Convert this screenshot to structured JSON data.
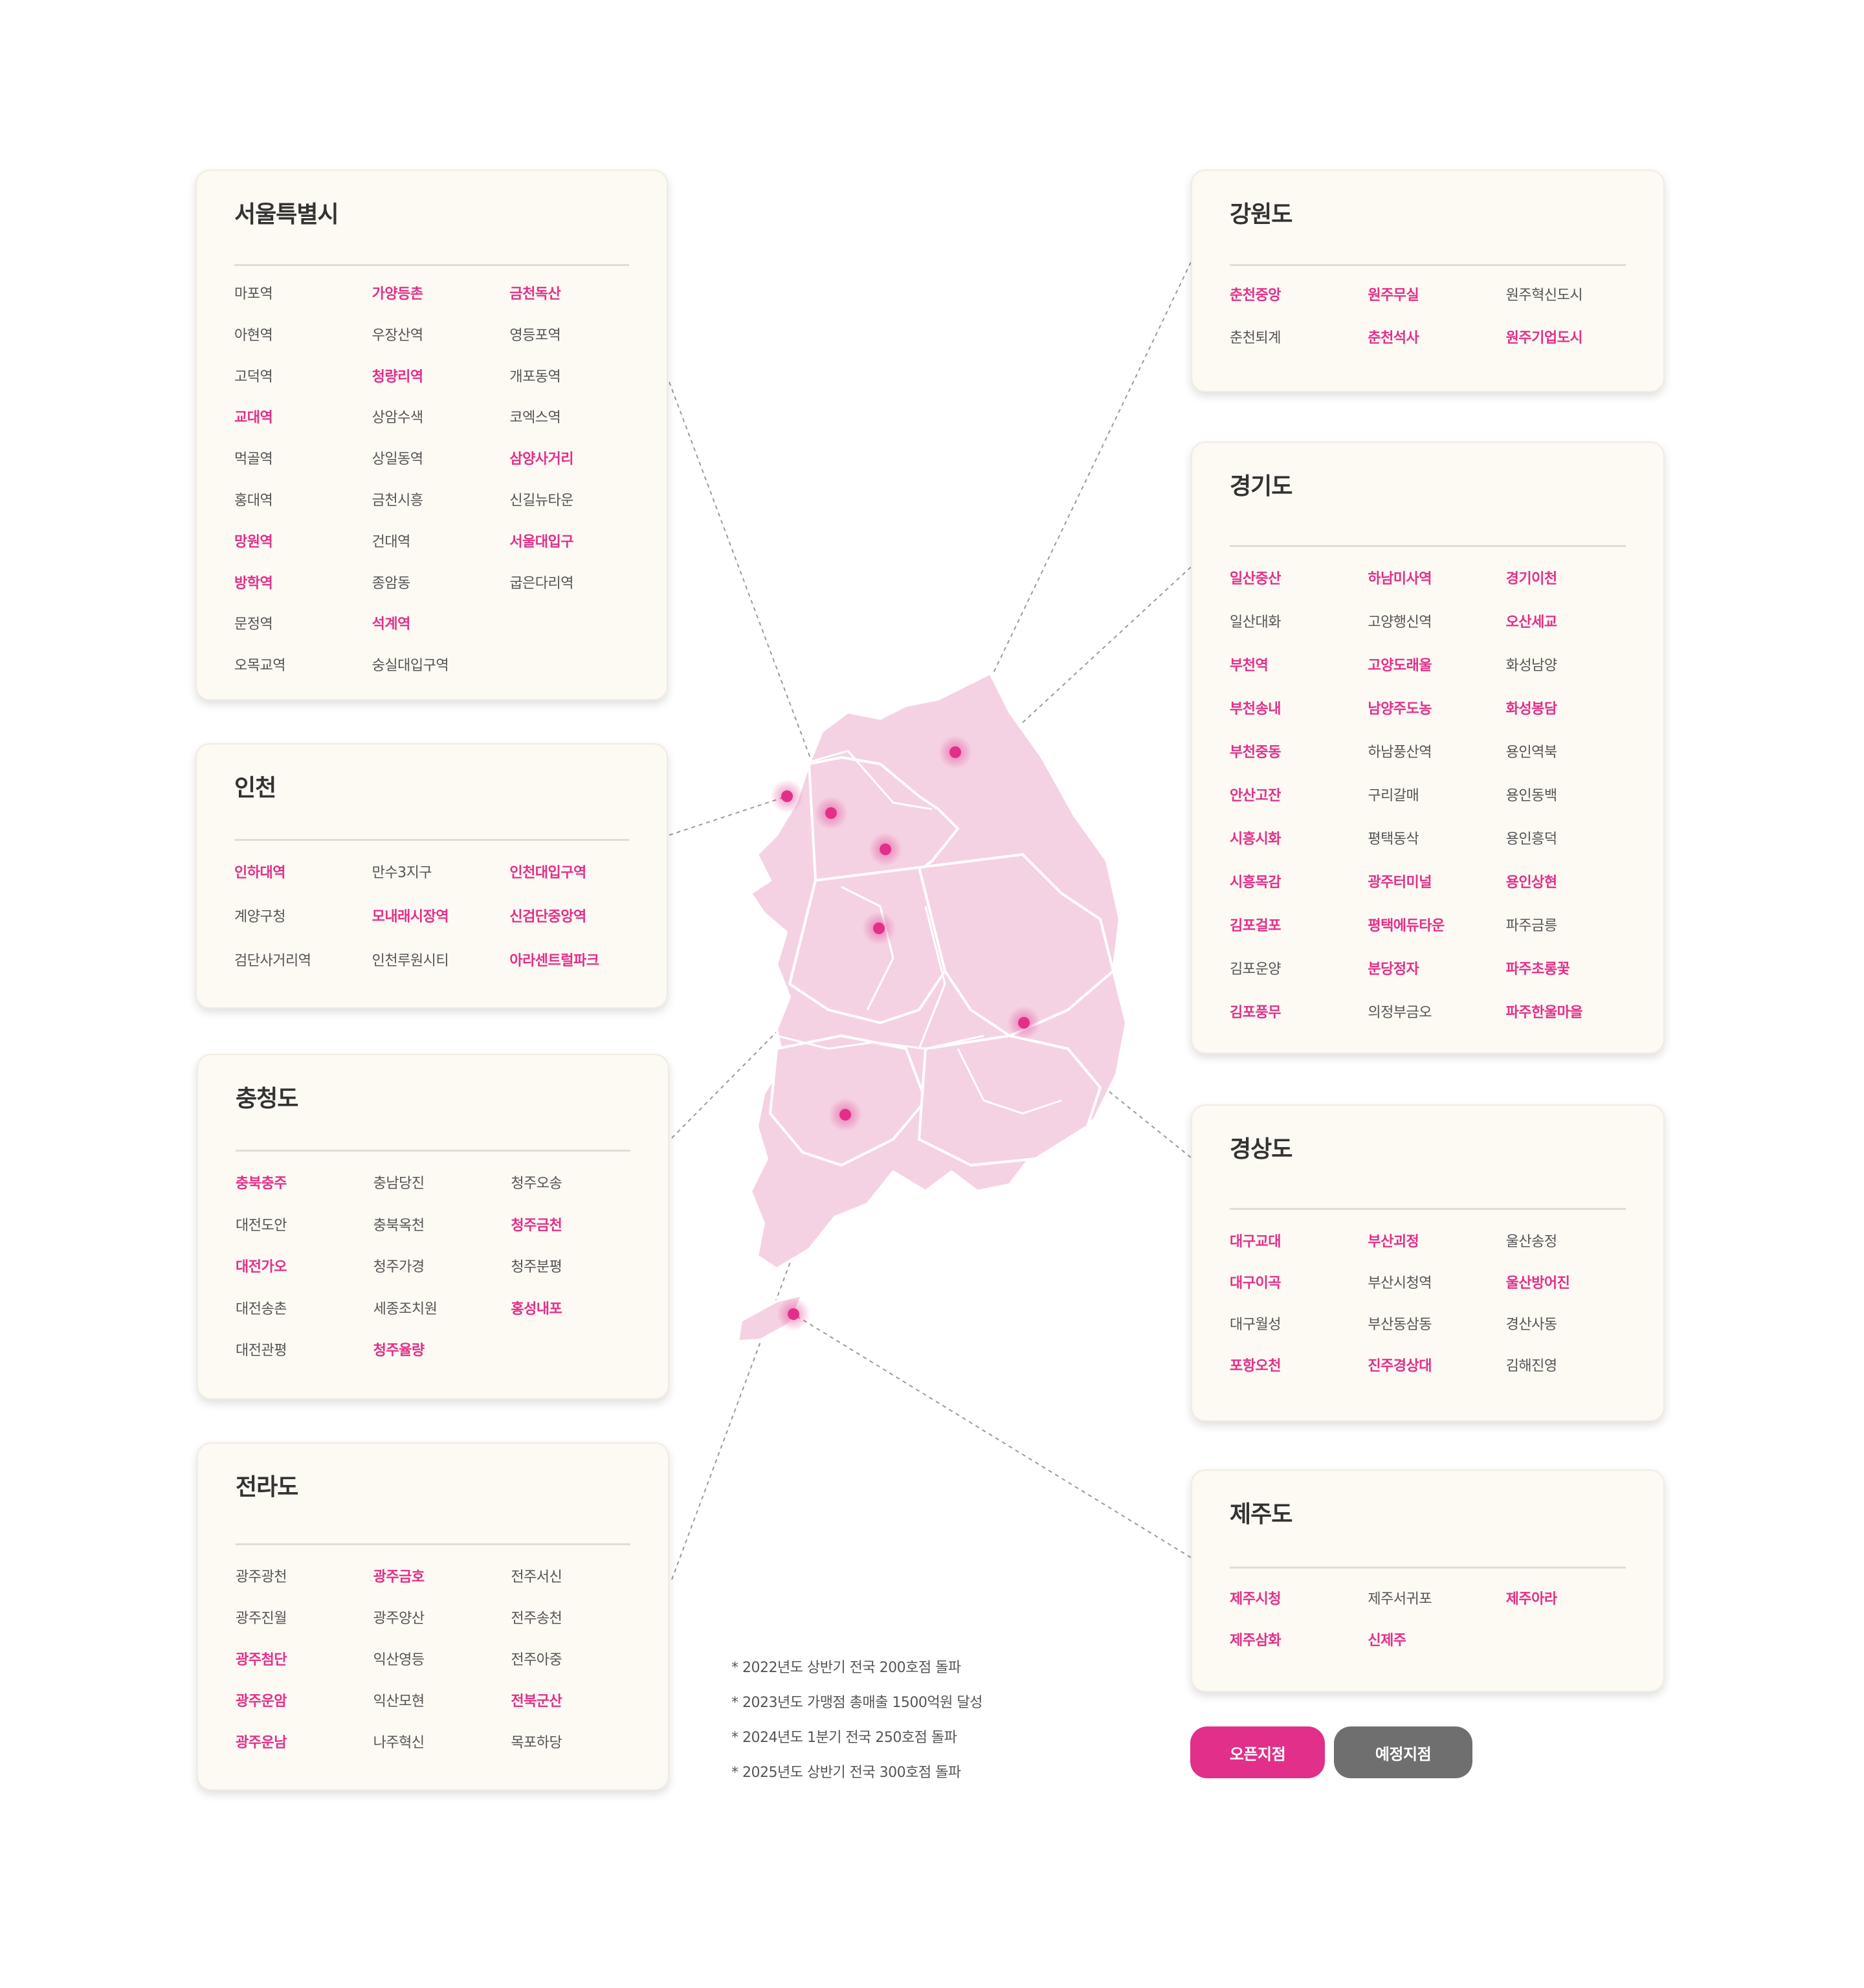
{
  "regions": {
    "seoul": {
      "title": "서울특별시",
      "items": [
        {
          "name": "마포역",
          "open": false
        },
        {
          "name": "가양등촌",
          "open": true
        },
        {
          "name": "금천독산",
          "open": true
        },
        {
          "name": "아현역",
          "open": false
        },
        {
          "name": "우장산역",
          "open": false
        },
        {
          "name": "영등포역",
          "open": false
        },
        {
          "name": "고덕역",
          "open": false
        },
        {
          "name": "청량리역",
          "open": true
        },
        {
          "name": "개포동역",
          "open": false
        },
        {
          "name": "교대역",
          "open": true
        },
        {
          "name": "상암수색",
          "open": false
        },
        {
          "name": "코엑스역",
          "open": false
        },
        {
          "name": "먹골역",
          "open": false
        },
        {
          "name": "상일동역",
          "open": false
        },
        {
          "name": "삼양사거리",
          "open": true
        },
        {
          "name": "홍대역",
          "open": false
        },
        {
          "name": "금천시흥",
          "open": false
        },
        {
          "name": "신길뉴타운",
          "open": false
        },
        {
          "name": "망원역",
          "open": true
        },
        {
          "name": "건대역",
          "open": false
        },
        {
          "name": "서울대입구",
          "open": true
        },
        {
          "name": "방학역",
          "open": true
        },
        {
          "name": "종암동",
          "open": false
        },
        {
          "name": "굽은다리역",
          "open": false
        },
        {
          "name": "문정역",
          "open": false
        },
        {
          "name": "석계역",
          "open": true
        },
        {
          "name": "",
          "open": false
        },
        {
          "name": "오목교역",
          "open": false
        },
        {
          "name": "숭실대입구역",
          "open": false
        },
        {
          "name": "",
          "open": false
        }
      ]
    },
    "incheon": {
      "title": "인천",
      "items": [
        {
          "name": "인하대역",
          "open": true
        },
        {
          "name": "만수3지구",
          "open": false
        },
        {
          "name": "인천대입구역",
          "open": true
        },
        {
          "name": "계양구청",
          "open": false
        },
        {
          "name": "모내래시장역",
          "open": true
        },
        {
          "name": "신검단중앙역",
          "open": true
        },
        {
          "name": "검단사거리역",
          "open": false
        },
        {
          "name": "인천루원시티",
          "open": false
        },
        {
          "name": "아라센트럴파크",
          "open": true
        }
      ]
    },
    "chungcheong": {
      "title": "충청도",
      "items": [
        {
          "name": "충북충주",
          "open": true
        },
        {
          "name": "충남당진",
          "open": false
        },
        {
          "name": "청주오송",
          "open": false
        },
        {
          "name": "대전도안",
          "open": false
        },
        {
          "name": "충북옥천",
          "open": false
        },
        {
          "name": "청주금천",
          "open": true
        },
        {
          "name": "대전가오",
          "open": true
        },
        {
          "name": "청주가경",
          "open": false
        },
        {
          "name": "청주분평",
          "open": false
        },
        {
          "name": "대전송촌",
          "open": false
        },
        {
          "name": "세종조치원",
          "open": false
        },
        {
          "name": "홍성내포",
          "open": true
        },
        {
          "name": "대전관평",
          "open": false
        },
        {
          "name": "청주율량",
          "open": true
        },
        {
          "name": "",
          "open": false
        }
      ]
    },
    "jeolla": {
      "title": "전라도",
      "items": [
        {
          "name": "광주광천",
          "open": false
        },
        {
          "name": "광주금호",
          "open": true
        },
        {
          "name": "전주서신",
          "open": false
        },
        {
          "name": "광주진월",
          "open": false
        },
        {
          "name": "광주양산",
          "open": false
        },
        {
          "name": "전주송천",
          "open": false
        },
        {
          "name": "광주첨단",
          "open": true
        },
        {
          "name": "익산영등",
          "open": false
        },
        {
          "name": "전주아중",
          "open": false
        },
        {
          "name": "광주운암",
          "open": true
        },
        {
          "name": "익산모현",
          "open": false
        },
        {
          "name": "전북군산",
          "open": true
        },
        {
          "name": "광주운남",
          "open": true
        },
        {
          "name": "나주혁신",
          "open": false
        },
        {
          "name": "목포하당",
          "open": false
        }
      ]
    },
    "gangwon": {
      "title": "강원도",
      "items": [
        {
          "name": "춘천중앙",
          "open": true
        },
        {
          "name": "원주무실",
          "open": true
        },
        {
          "name": "원주혁신도시",
          "open": false
        },
        {
          "name": "춘천퇴계",
          "open": false
        },
        {
          "name": "춘천석사",
          "open": true
        },
        {
          "name": "원주기업도시",
          "open": true
        }
      ]
    },
    "gyeonggi": {
      "title": "경기도",
      "items": [
        {
          "name": "일산중산",
          "open": true
        },
        {
          "name": "하남미사역",
          "open": true
        },
        {
          "name": "경기이천",
          "open": true
        },
        {
          "name": "일산대화",
          "open": false
        },
        {
          "name": "고양행신역",
          "open": false
        },
        {
          "name": "오산세교",
          "open": true
        },
        {
          "name": "부천역",
          "open": true
        },
        {
          "name": "고양도래울",
          "open": true
        },
        {
          "name": "화성남양",
          "open": false
        },
        {
          "name": "부천송내",
          "open": true
        },
        {
          "name": "남양주도농",
          "open": true
        },
        {
          "name": "화성봉담",
          "open": true
        },
        {
          "name": "부천중동",
          "open": true
        },
        {
          "name": "하남풍산역",
          "open": false
        },
        {
          "name": "용인역북",
          "open": false
        },
        {
          "name": "안산고잔",
          "open": true
        },
        {
          "name": "구리갈매",
          "open": false
        },
        {
          "name": "용인동백",
          "open": false
        },
        {
          "name": "시흥시화",
          "open": true
        },
        {
          "name": "평택동삭",
          "open": false
        },
        {
          "name": "용인흥덕",
          "open": false
        },
        {
          "name": "시흥목감",
          "open": true
        },
        {
          "name": "광주터미널",
          "open": true
        },
        {
          "name": "용인상현",
          "open": true
        },
        {
          "name": "김포걸포",
          "open": true
        },
        {
          "name": "평택에듀타운",
          "open": true
        },
        {
          "name": "파주금릉",
          "open": false
        },
        {
          "name": "김포운양",
          "open": false
        },
        {
          "name": "분당정자",
          "open": true
        },
        {
          "name": "파주초롱꽃",
          "open": true
        },
        {
          "name": "김포풍무",
          "open": true
        },
        {
          "name": "의정부금오",
          "open": false
        },
        {
          "name": "파주한울마을",
          "open": true
        }
      ]
    },
    "gyeongsang": {
      "title": "경상도",
      "items": [
        {
          "name": "대구교대",
          "open": true
        },
        {
          "name": "부산괴정",
          "open": true
        },
        {
          "name": "울산송정",
          "open": false
        },
        {
          "name": "대구이곡",
          "open": true
        },
        {
          "name": "부산시청역",
          "open": false
        },
        {
          "name": "울산방어진",
          "open": true
        },
        {
          "name": "대구월성",
          "open": false
        },
        {
          "name": "부산동삼동",
          "open": false
        },
        {
          "name": "경산사동",
          "open": false
        },
        {
          "name": "포항오천",
          "open": true
        },
        {
          "name": "진주경상대",
          "open": true
        },
        {
          "name": "김해진영",
          "open": false
        }
      ]
    },
    "jeju": {
      "title": "제주도",
      "items": [
        {
          "name": "제주시청",
          "open": true
        },
        {
          "name": "제주서귀포",
          "open": false
        },
        {
          "name": "제주아라",
          "open": true
        },
        {
          "name": "제주삼화",
          "open": true
        },
        {
          "name": "신제주",
          "open": true
        },
        {
          "name": "",
          "open": false
        }
      ]
    }
  },
  "notes": [
    "* 2022년도 상반기 전국 200호점 돌파",
    "* 2023년도 가맹점 총매출 1500억원 달성",
    "* 2024년도 1분기 전국 250호점 돌파",
    "* 2025년도 상반기 전국 300호점 돌파"
  ],
  "legend": {
    "open_label": "오픈지점",
    "planned_label": "예정지점"
  },
  "colors": {
    "accent": "#e22f8a",
    "planned": "#6f6f6f",
    "card_bg": "#fdf9f3",
    "map_fill": "#f4d2e3"
  }
}
